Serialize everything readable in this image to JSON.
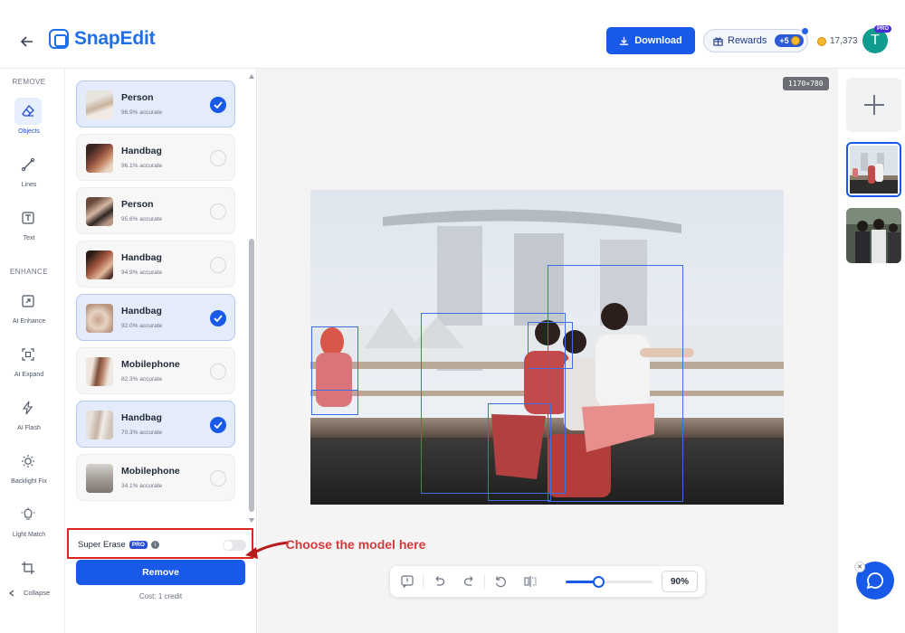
{
  "header": {
    "logo_text": "SnapEdit",
    "download_label": "Download",
    "rewards_label": "Rewards",
    "rewards_badge": "+5",
    "credits": "17,373",
    "avatar_initial": "T",
    "avatar_badge": "PRO"
  },
  "tools": {
    "remove_section": "REMOVE",
    "enhance_section": "ENHANCE",
    "items": [
      {
        "label": "Objects",
        "icon": "eraser-icon",
        "active": true
      },
      {
        "label": "Lines",
        "icon": "line-brush-icon",
        "active": false
      },
      {
        "label": "Text",
        "icon": "text-icon",
        "active": false
      },
      {
        "label": "AI Enhance",
        "icon": "enhance-icon",
        "active": false
      },
      {
        "label": "AI Expand",
        "icon": "expand-icon",
        "active": false
      },
      {
        "label": "AI Flash",
        "icon": "flash-icon",
        "active": false
      },
      {
        "label": "Backlight Fix",
        "icon": "sun-icon",
        "active": false
      },
      {
        "label": "Light Match",
        "icon": "bulb-icon",
        "active": false
      },
      {
        "label": "",
        "icon": "crop-icon",
        "active": false
      }
    ],
    "collapse_label": "Collapse"
  },
  "objects": {
    "items": [
      {
        "name": "Person",
        "accuracy": "96.9% accurate",
        "selected": true
      },
      {
        "name": "Handbag",
        "accuracy": "96.1% accurate",
        "selected": false
      },
      {
        "name": "Person",
        "accuracy": "95.6% accurate",
        "selected": false
      },
      {
        "name": "Handbag",
        "accuracy": "94.9% accurate",
        "selected": false
      },
      {
        "name": "Handbag",
        "accuracy": "92.0% accurate",
        "selected": true
      },
      {
        "name": "Mobilephone",
        "accuracy": "82.3% accurate",
        "selected": false
      },
      {
        "name": "Handbag",
        "accuracy": "70.3% accurate",
        "selected": true
      },
      {
        "name": "Mobilephone",
        "accuracy": "34.1% accurate",
        "selected": false
      }
    ],
    "super_erase_label": "Super Erase",
    "pro_tag": "PRO",
    "info": "i",
    "remove_label": "Remove",
    "cost_label": "Cost: 1 credit"
  },
  "canvas": {
    "dimensions": "1170×780",
    "annotation": "Choose the model here",
    "zoom_level": "90%",
    "zoom_fraction": 0.37
  },
  "colors": {
    "accent": "#1959e8",
    "highlight_red": "#e02424",
    "annotation_red": "#d23c3c"
  }
}
